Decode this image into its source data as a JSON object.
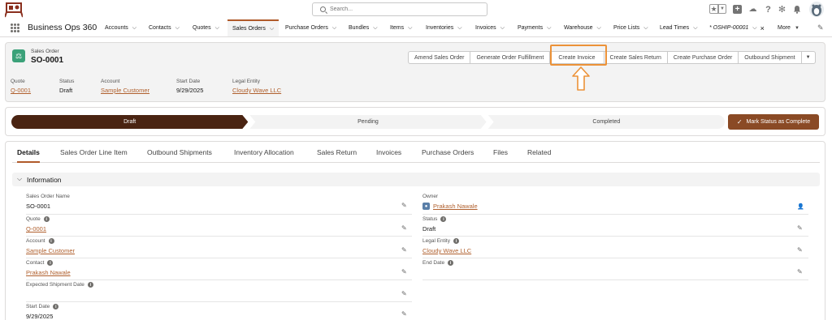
{
  "header": {
    "search_placeholder": "Search...",
    "icons": [
      "favorites-star-icon",
      "favorites-dropdown-icon",
      "add-icon",
      "trailhead-icon",
      "help-icon",
      "setup-gear-icon",
      "notifications-bell-icon",
      "avatar"
    ]
  },
  "nav": {
    "app_name": "Business Ops 360",
    "items": [
      {
        "label": "Accounts"
      },
      {
        "label": "Contacts"
      },
      {
        "label": "Quotes"
      },
      {
        "label": "Sales Orders"
      },
      {
        "label": "Purchase Orders"
      },
      {
        "label": "Bundles"
      },
      {
        "label": "Items"
      },
      {
        "label": "Inventories"
      },
      {
        "label": "Invoices"
      },
      {
        "label": "Payments"
      },
      {
        "label": "Warehouse"
      },
      {
        "label": "Price Lists"
      },
      {
        "label": "Lead Times"
      }
    ],
    "temp_tab": "* OSHIP-00001",
    "more": "More"
  },
  "record": {
    "object_label": "Sales Order",
    "name": "SO-0001",
    "actions": [
      "Amend Sales Order",
      "Generate Order Fulfillment",
      "Create Invoice",
      "Create Sales Return",
      "Create Purchase Order",
      "Outbound Shipment"
    ],
    "highlights": [
      {
        "label": "Quote",
        "value": "Q-0001"
      },
      {
        "label": "Status",
        "value": "Draft"
      },
      {
        "label": "Account",
        "value": "Sample Customer"
      },
      {
        "label": "Start Date",
        "value": "9/29/2025"
      },
      {
        "label": "Legal Entity",
        "value": "Cloudy Wave LLC"
      }
    ]
  },
  "path": {
    "steps": [
      "Draft",
      "Pending",
      "Completed"
    ],
    "mark_button": "Mark Status as Complete"
  },
  "tabs": [
    "Details",
    "Sales Order Line Item",
    "Outbound Shipments",
    "Inventory Allocation",
    "Sales Return",
    "Invoices",
    "Purchase Orders",
    "Files",
    "Related"
  ],
  "section": {
    "title": "Information",
    "left_fields": [
      {
        "label": "Sales Order Name",
        "value": "SO-0001"
      },
      {
        "label": "Quote",
        "value": "Q-0001"
      },
      {
        "label": "Account",
        "value": "Sample Customer"
      },
      {
        "label": "Contact",
        "value": "Prakash Nawale"
      },
      {
        "label": "Expected Shipment Date",
        "value": ""
      },
      {
        "label": "Start Date",
        "value": "9/29/2025"
      }
    ],
    "right_fields": [
      {
        "label": "Owner",
        "value": "Prakash Nawale"
      },
      {
        "label": "Status",
        "value": "Draft"
      },
      {
        "label": "Legal Entity",
        "value": "Cloudy Wave LLC"
      },
      {
        "label": "End Date",
        "value": ""
      }
    ]
  },
  "colors": {
    "accent": "#b05a2a",
    "path_active": "#4a2412",
    "mark_button": "#8a4a25",
    "highlight": "#ec9238",
    "link": "#b0602e"
  }
}
